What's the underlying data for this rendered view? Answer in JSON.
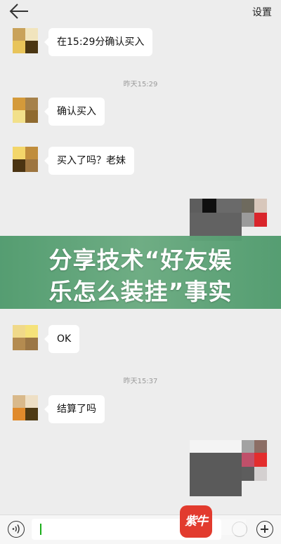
{
  "header": {
    "settings_label": "设置"
  },
  "messages": [
    {
      "type": "text",
      "text": "在15:29分确认买入"
    },
    {
      "type": "time",
      "text": "昨天15:29"
    },
    {
      "type": "text",
      "text": "确认买入"
    },
    {
      "type": "text",
      "text": "买入了吗？老妹"
    },
    {
      "type": "text",
      "text": "OK"
    },
    {
      "type": "time",
      "text": "昨天15:37"
    },
    {
      "type": "text",
      "text": "结算了吗"
    }
  ],
  "banner": {
    "line1": "分享技术“好友娱",
    "line2": "乐怎么装挂”事实"
  },
  "logo_text": "紫牛",
  "colors": {
    "background": "#ededed",
    "bubble": "#ffffff",
    "banner": "#5aa074",
    "logo": "#e23b2e"
  },
  "icons": [
    "back-arrow-icon",
    "voice-icon",
    "emoji-icon",
    "plus-icon"
  ]
}
